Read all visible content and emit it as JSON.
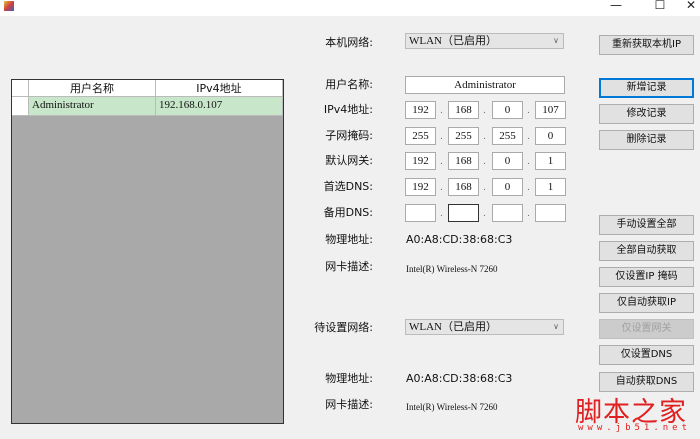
{
  "window": {
    "minimize": "—",
    "maximize": "☐",
    "close": "✕"
  },
  "grid": {
    "columns": [
      "用户名称",
      "IPv4地址"
    ],
    "rows": [
      {
        "user": "Administrator",
        "ip": "192.168.0.107"
      }
    ]
  },
  "local": {
    "network_label": "本机网络:",
    "network_value": "WLAN（已启用）",
    "username_label": "用户名称:",
    "username_value": "Administrator",
    "ipv4_label": "IPv4地址:",
    "ipv4": [
      "192",
      "168",
      "0",
      "107"
    ],
    "mask_label": "子网掩码:",
    "mask": [
      "255",
      "255",
      "255",
      "0"
    ],
    "gateway_label": "默认网关:",
    "gateway": [
      "192",
      "168",
      "0",
      "1"
    ],
    "dns1_label": "首选DNS:",
    "dns1": [
      "192",
      "168",
      "0",
      "1"
    ],
    "dns2_label": "备用DNS:",
    "dns2": [
      "",
      "",
      "",
      ""
    ],
    "mac_label": "物理地址:",
    "mac": "A0:A8:CD:38:68:C3",
    "desc_label": "网卡描述:",
    "desc": "Intel(R) Wireless-N 7260"
  },
  "target": {
    "network_label": "待设置网络:",
    "network_value": "WLAN（已启用）",
    "mac_label": "物理地址:",
    "mac": "A0:A8:CD:38:68:C3",
    "desc_label": "网卡描述:",
    "desc": "Intel(R) Wireless-N 7260"
  },
  "buttons": {
    "refresh": "重新获取本机IP",
    "add": "新增记录",
    "edit": "修改记录",
    "delete": "删除记录",
    "manual_all": "手动设置全部",
    "auto_all": "全部自动获取",
    "ip_mask_only": "仅设置IP 掩码",
    "auto_ip_only": "仅自动获取IP",
    "gateway_only": "仅设置网关",
    "dns_only": "仅设置DNS",
    "auto_dns": "自动获取DNS"
  },
  "watermark": {
    "title": "脚本之家",
    "url": "www.jb51.net"
  }
}
